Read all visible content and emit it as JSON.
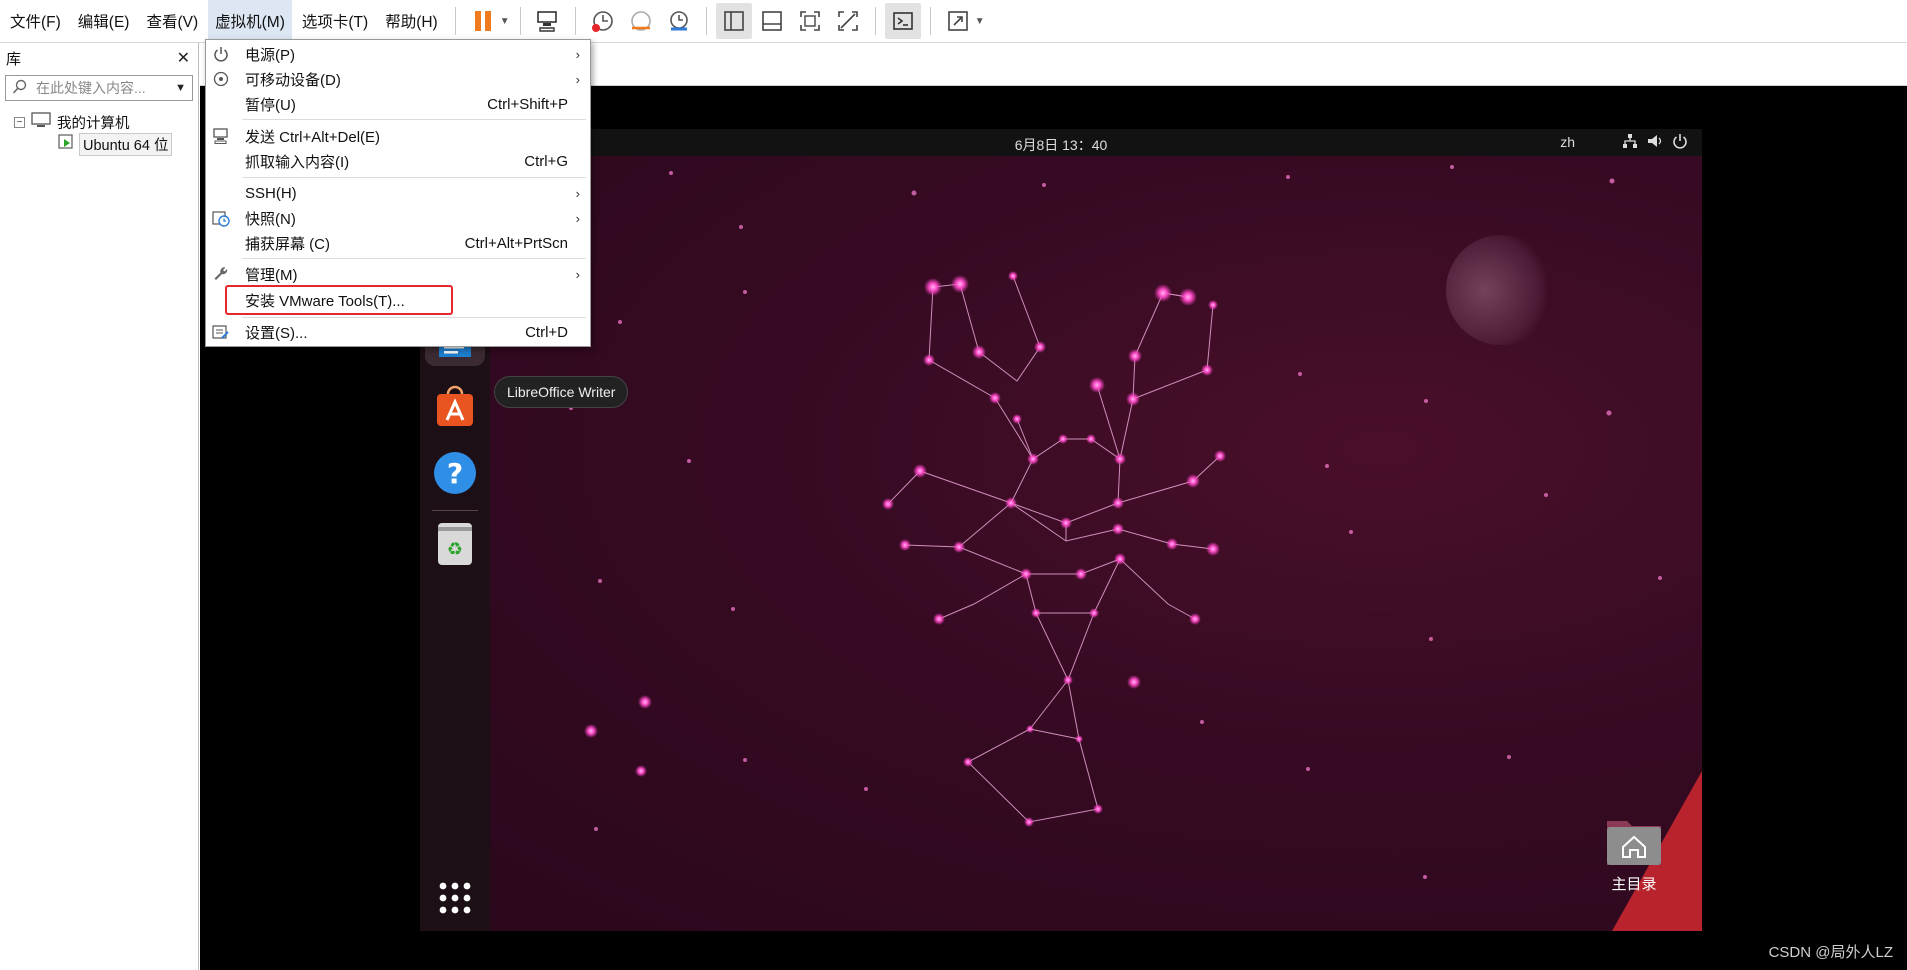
{
  "menubar": {
    "items": [
      "文件(F)",
      "编辑(E)",
      "查看(V)",
      "虚拟机(M)",
      "选项卡(T)",
      "帮助(H)"
    ],
    "active_index": 3
  },
  "toolbar": {
    "icons": [
      "pause-icon",
      "send-keys-icon",
      "snapshot-icon",
      "revert-snapshot-icon",
      "manage-snapshots-icon",
      "sidebar-view-icon",
      "thumbnail-view-icon",
      "fit-guest-icon",
      "unity-icon",
      "console-view-icon",
      "fullscreen-icon"
    ]
  },
  "library": {
    "title": "库",
    "search_placeholder": "在此处键入内容...",
    "tree": {
      "root": "我的计算机",
      "child": "Ubuntu 64 位"
    }
  },
  "vm_menu": {
    "items": [
      {
        "label": "电源(P)",
        "shortcut": "",
        "submenu": true,
        "icon": "power-icon"
      },
      {
        "label": "可移动设备(D)",
        "shortcut": "",
        "submenu": true,
        "icon": "removable-device-icon"
      },
      {
        "label": "暂停(U)",
        "shortcut": "Ctrl+Shift+P",
        "submenu": false,
        "icon": ""
      },
      {
        "label": "发送 Ctrl+Alt+Del(E)",
        "shortcut": "",
        "submenu": false,
        "icon": "send-keys-icon"
      },
      {
        "label": "抓取输入内容(I)",
        "shortcut": "Ctrl+G",
        "submenu": false,
        "icon": ""
      },
      {
        "label": "SSH(H)",
        "shortcut": "",
        "submenu": true,
        "icon": ""
      },
      {
        "label": "快照(N)",
        "shortcut": "",
        "submenu": true,
        "icon": "snapshot-icon"
      },
      {
        "label": "捕获屏幕 (C)",
        "shortcut": "Ctrl+Alt+PrtScn",
        "submenu": false,
        "icon": ""
      },
      {
        "label": "管理(M)",
        "shortcut": "",
        "submenu": true,
        "icon": "wrench-icon"
      },
      {
        "label": "安装 VMware Tools(T)...",
        "shortcut": "",
        "submenu": false,
        "icon": ""
      },
      {
        "label": "设置(S)...",
        "shortcut": "Ctrl+D",
        "submenu": false,
        "icon": "settings-icon"
      }
    ],
    "highlighted_item": "安装 VMware Tools(T)...",
    "highlight_color": "#e5262b"
  },
  "guest": {
    "clock": "6月8日  13：40",
    "language": "zh",
    "tray_icons": [
      "network-icon",
      "volume-icon",
      "power-icon"
    ],
    "tooltip": "LibreOffice Writer",
    "dock_icons": [
      "libreoffice-writer-icon",
      "app-center-icon",
      "help-icon",
      "trash-icon",
      "show-apps-icon"
    ],
    "desktop_icon_label": "主目录",
    "wallpaper_colors": [
      "#2a081c",
      "#4a0f2a",
      "#b8232d"
    ]
  },
  "watermark": "CSDN @局外人LZ"
}
